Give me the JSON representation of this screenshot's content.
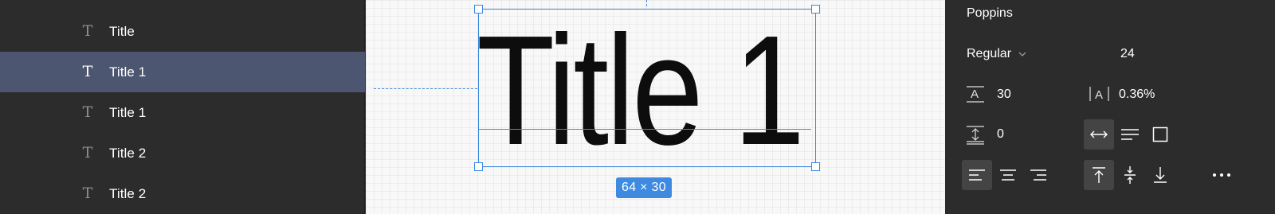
{
  "layers": [
    {
      "label": "Title",
      "selected": false,
      "icon": "text-icon"
    },
    {
      "label": "Title 1",
      "selected": true,
      "icon": "text-icon"
    },
    {
      "label": "Title 1",
      "selected": false,
      "icon": "text-icon"
    },
    {
      "label": "Title 2",
      "selected": false,
      "icon": "text-icon"
    },
    {
      "label": "Title 2",
      "selected": false,
      "icon": "text-icon"
    }
  ],
  "canvas": {
    "text": "Title 1",
    "size_badge": "64 × 30",
    "selection_color": "#3d8ae0"
  },
  "properties": {
    "font_family": "Poppins",
    "font_weight": "Regular",
    "font_size": "24",
    "line_height": "30",
    "letter_spacing": "0.36%",
    "paragraph_spacing": "0",
    "resize_mode": "auto-width",
    "text_align": "left",
    "vertical_align": "top",
    "icons": {
      "line_height": "line-height-icon",
      "letter_spacing": "letter-spacing-icon",
      "paragraph_spacing": "paragraph-spacing-icon",
      "more": "more-icon"
    }
  },
  "colors": {
    "panel_bg": "#2c2c2c",
    "selected_row": "#4d5670",
    "accent": "#3d8ae0"
  }
}
